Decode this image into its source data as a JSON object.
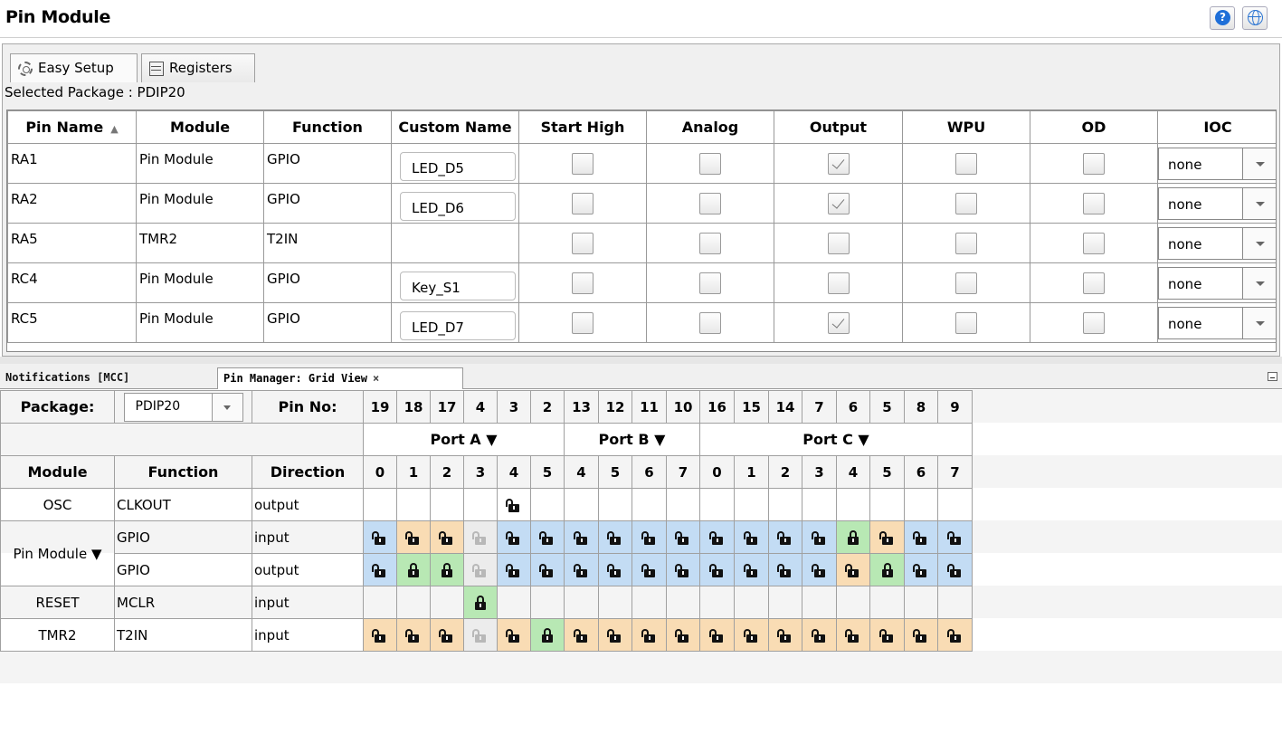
{
  "title": "Pin Module",
  "header_buttons": {
    "help": "?"
  },
  "tabs": [
    "Easy Setup",
    "Registers"
  ],
  "selected_package_label": "Selected Package : PDIP20",
  "pin_table": {
    "columns": [
      "Pin Name",
      "Module",
      "Function",
      "Custom Name",
      "Start High",
      "Analog",
      "Output",
      "WPU",
      "OD",
      "IOC"
    ],
    "rows": [
      {
        "pin": "RA1",
        "module": "Pin Module",
        "function": "GPIO",
        "custom": "LED_D5",
        "start_high": false,
        "analog": false,
        "output": true,
        "wpu": false,
        "od": false,
        "ioc": "none"
      },
      {
        "pin": "RA2",
        "module": "Pin Module",
        "function": "GPIO",
        "custom": "LED_D6",
        "start_high": false,
        "analog": false,
        "output": true,
        "wpu": false,
        "od": false,
        "ioc": "none"
      },
      {
        "pin": "RA5",
        "module": "TMR2",
        "function": "T2IN",
        "custom": "",
        "start_high": false,
        "analog": false,
        "output": false,
        "wpu": false,
        "od": false,
        "ioc": "none"
      },
      {
        "pin": "RC4",
        "module": "Pin Module",
        "function": "GPIO",
        "custom": "Key_S1",
        "start_high": false,
        "analog": false,
        "output": false,
        "wpu": false,
        "od": false,
        "ioc": "none"
      },
      {
        "pin": "RC5",
        "module": "Pin Module",
        "function": "GPIO",
        "custom": "LED_D7",
        "start_high": false,
        "analog": false,
        "output": true,
        "wpu": false,
        "od": false,
        "ioc": "none"
      }
    ]
  },
  "bottom_tabs": {
    "notifications": "Notifications [MCC]",
    "pin_manager": "Pin Manager: Grid View",
    "close": "×"
  },
  "pin_manager": {
    "package_label": "Package:",
    "package_value": "PDIP20",
    "pin_no_label": "Pin No:",
    "pin_numbers": [
      "19",
      "18",
      "17",
      "4",
      "3",
      "2",
      "13",
      "12",
      "11",
      "10",
      "16",
      "15",
      "14",
      "7",
      "6",
      "5",
      "8",
      "9"
    ],
    "ports": [
      {
        "name": "Port A ▼",
        "span": 6
      },
      {
        "name": "Port B ▼",
        "span": 4
      },
      {
        "name": "Port C ▼",
        "span": 8
      }
    ],
    "header": {
      "module": "Module",
      "function": "Function",
      "direction": "Direction"
    },
    "bits": [
      "0",
      "1",
      "2",
      "3",
      "4",
      "5",
      "4",
      "5",
      "6",
      "7",
      "0",
      "1",
      "2",
      "3",
      "4",
      "5",
      "6",
      "7"
    ],
    "rows": [
      {
        "module": "OSC",
        "module_rows": 1,
        "function": "CLKOUT",
        "direction": "output",
        "band": "white",
        "cells": [
          "",
          "",
          "",
          "",
          "w:open",
          "",
          "",
          "",
          "",
          "",
          "",
          "",
          "",
          "",
          "",
          "",
          "",
          ""
        ]
      },
      {
        "module": "Pin Module ▼",
        "module_rows": 2,
        "function": "GPIO",
        "direction": "input",
        "band": "gray",
        "cells": [
          "blue:open",
          "orange:open",
          "orange:open",
          "gray:dim",
          "blue:open",
          "blue:open",
          "blue:open",
          "blue:open",
          "blue:open",
          "blue:open",
          "blue:open",
          "blue:open",
          "blue:open",
          "blue:open",
          "green:locked",
          "orange:open",
          "blue:open",
          "blue:open"
        ]
      },
      {
        "module": "",
        "module_rows": 0,
        "function": "GPIO",
        "direction": "output",
        "band": "white",
        "cells": [
          "blue:open",
          "green:locked",
          "green:locked",
          "gray:dim",
          "blue:open",
          "blue:open",
          "blue:open",
          "blue:open",
          "blue:open",
          "blue:open",
          "blue:open",
          "blue:open",
          "blue:open",
          "blue:open",
          "orange:open",
          "green:locked",
          "blue:open",
          "blue:open"
        ]
      },
      {
        "module": "RESET",
        "module_rows": 1,
        "function": "MCLR",
        "direction": "input",
        "band": "gray",
        "cells": [
          "",
          "",
          "",
          "green:locked",
          "",
          "",
          "",
          "",
          "",
          "",
          "",
          "",
          "",
          "",
          "",
          "",
          "",
          ""
        ]
      },
      {
        "module": "TMR2",
        "module_rows": 1,
        "function": "T2IN",
        "direction": "input",
        "band": "white",
        "cells": [
          "orange:open",
          "orange:open",
          "orange:open",
          "gray:dim",
          "orange:open",
          "green:locked",
          "orange:open",
          "orange:open",
          "orange:open",
          "orange:open",
          "orange:open",
          "orange:open",
          "orange:open",
          "orange:open",
          "orange:open",
          "orange:open",
          "orange:open",
          "orange:open"
        ]
      }
    ]
  },
  "colors": {
    "blue": "#c3dcf4",
    "orange": "#f9dcb4",
    "green": "#b8e8b4",
    "gray": "#ececec",
    "help_blue": "#1f6fd8"
  },
  "icons": {
    "help": "help-icon",
    "globe": "globe-icon",
    "easy_setup": "gear-icon",
    "registers": "registers-icon",
    "lock_open": "unlocked-icon",
    "lock_closed": "locked-icon"
  }
}
